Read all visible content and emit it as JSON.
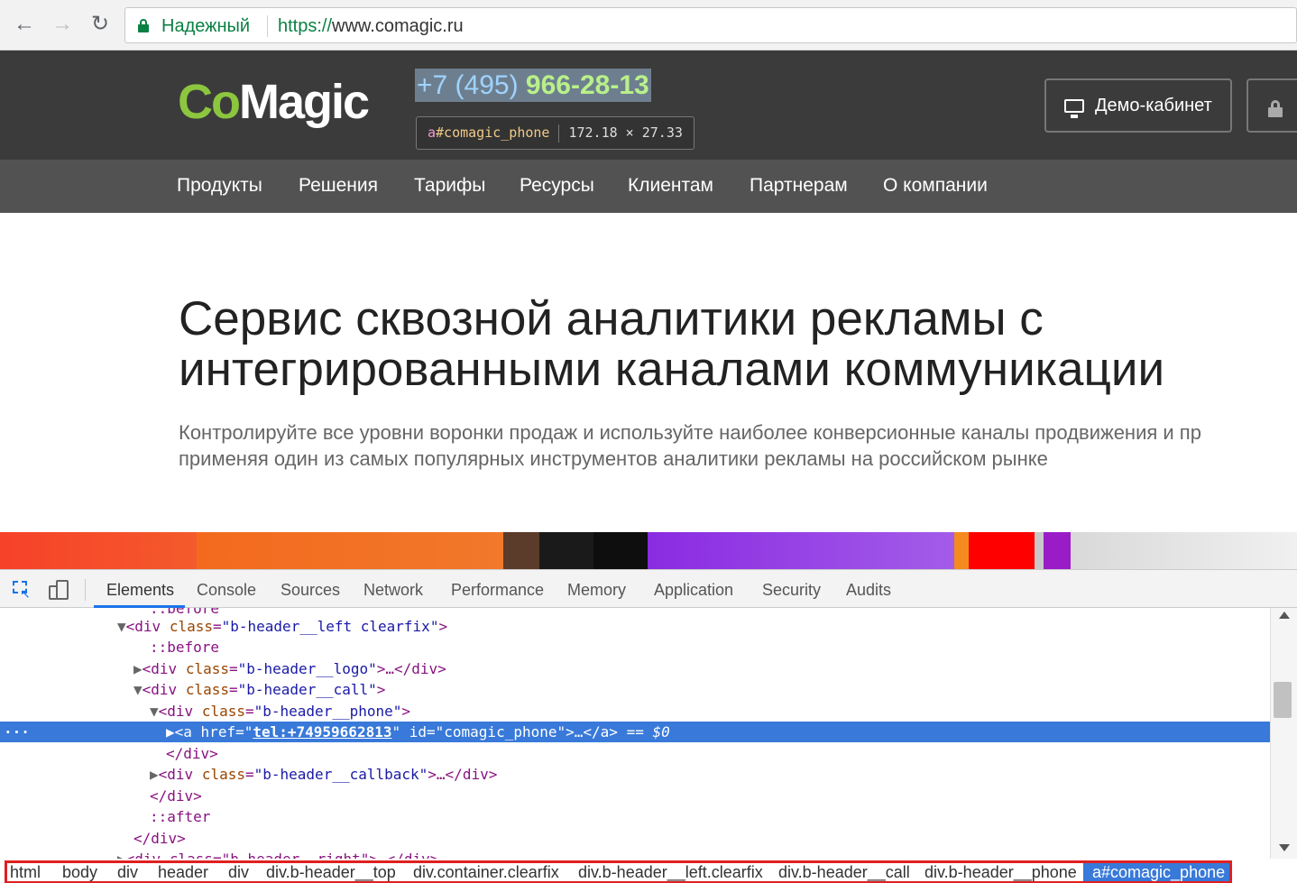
{
  "browser": {
    "back_icon": "←",
    "forward_icon": "→",
    "reload_icon": "↻",
    "secure_label": "Надежный",
    "url_scheme": "https://",
    "url_host": "www.comagic.ru"
  },
  "header": {
    "logo_co": "Co",
    "logo_magic": "Magic",
    "phone_prefix": "+7 (495) ",
    "phone_number": "966-28-13",
    "demo_label": "Демо-кабинет"
  },
  "inspect_tooltip": {
    "tag": "a",
    "id": "#comagic_phone",
    "size": "172.18 × 27.33"
  },
  "nav": {
    "items": [
      "Продукты",
      "Решения",
      "Тарифы",
      "Ресурсы",
      "Клиентам",
      "Партнерам",
      "О компании"
    ]
  },
  "hero": {
    "title_line1": "Сервис сквозной аналитики рекламы с",
    "title_line2": "интегрированными каналами коммуникации",
    "sub_line1": "Контролируйте все уровни воронки продаж и используйте наиболее конверсионные каналы продвижения и пр",
    "sub_line2": "применяя один из самых популярных инструментов аналитики рекламы на российском рынке"
  },
  "devtools": {
    "tabs": [
      "Elements",
      "Console",
      "Sources",
      "Network",
      "Performance",
      "Memory",
      "Application",
      "Security",
      "Audits"
    ],
    "active_tab": "Elements",
    "breadcrumb": [
      "html",
      "body",
      "div",
      "header",
      "div",
      "div.b-header__top",
      "div.container.clearfix",
      "div.b-header__left.clearfix",
      "div.b-header__call",
      "div.b-header__phone",
      "a#comagic_phone"
    ],
    "dom": {
      "l0": "::before",
      "l1_tag_open": "<div ",
      "l1_attr": "class",
      "l1_val": "\"b-header__left clearfix\"",
      "l1_close": ">",
      "l2": "::before",
      "l3_val": "\"b-header__logo\"",
      "l3_tail": ">…</div>",
      "l4_val": "\"b-header__call\"",
      "l5_val": "\"b-header__phone\"",
      "l6_href_attr": "href",
      "l6_href_val": "tel:+74959662813",
      "l6_id_attr": "id",
      "l6_id_val": "comagic_phone",
      "l6_tail": ">…</a>",
      "l6_marker": " == $0",
      "l7": "</div>",
      "l8_val": "\"b-header__callback\"",
      "l8_tail": ">…</div>",
      "l9": "</div>",
      "l10": "::after",
      "l11": "</div>",
      "l12": "<div class=\"b-header__right\">…</div>"
    }
  },
  "colors": {
    "secure_green": "#0b8043",
    "header_bg": "#3b3b3b",
    "nav_bg": "#525252",
    "logo_green": "#8cc63f",
    "devtools_selection": "#3879d9",
    "breadcrumb_highlight_border": "#e02020"
  }
}
